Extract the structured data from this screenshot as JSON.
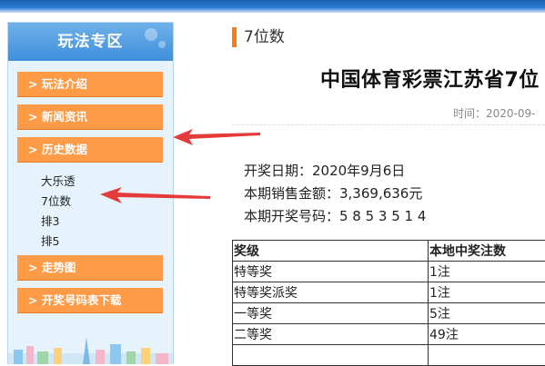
{
  "sidebar": {
    "title": "玩法专区",
    "menu": [
      {
        "label": "> 玩法介绍"
      },
      {
        "label": "> 新闻资讯"
      },
      {
        "label": "> 历史数据"
      }
    ],
    "sub_items": [
      "大乐透",
      "7位数",
      "排3",
      "排5"
    ],
    "menu2": [
      {
        "label": "> 走势图"
      },
      {
        "label": "> 开奖号码表下载"
      }
    ]
  },
  "breadcrumb": "7位数",
  "article": {
    "title": "中国体育彩票江苏省7位",
    "meta": "时间：2020-09-",
    "draw_date": "开奖日期：2020年9月6日",
    "sales": "本期销售金额：3,369,636元",
    "numbers": "本期开奖号码：5 8 5 3 5 1 4"
  },
  "table": {
    "headers": [
      "奖级",
      "本地中奖注数"
    ],
    "rows": [
      [
        "特等奖",
        "1注"
      ],
      [
        "特等奖派奖",
        "1注"
      ],
      [
        "一等奖",
        "5注"
      ],
      [
        "二等奖",
        "49注"
      ],
      [
        "",
        ""
      ]
    ]
  },
  "colors": {
    "accent": "#ff9a47",
    "header": "#3f8fdc",
    "arrow": "#e53a3a"
  }
}
